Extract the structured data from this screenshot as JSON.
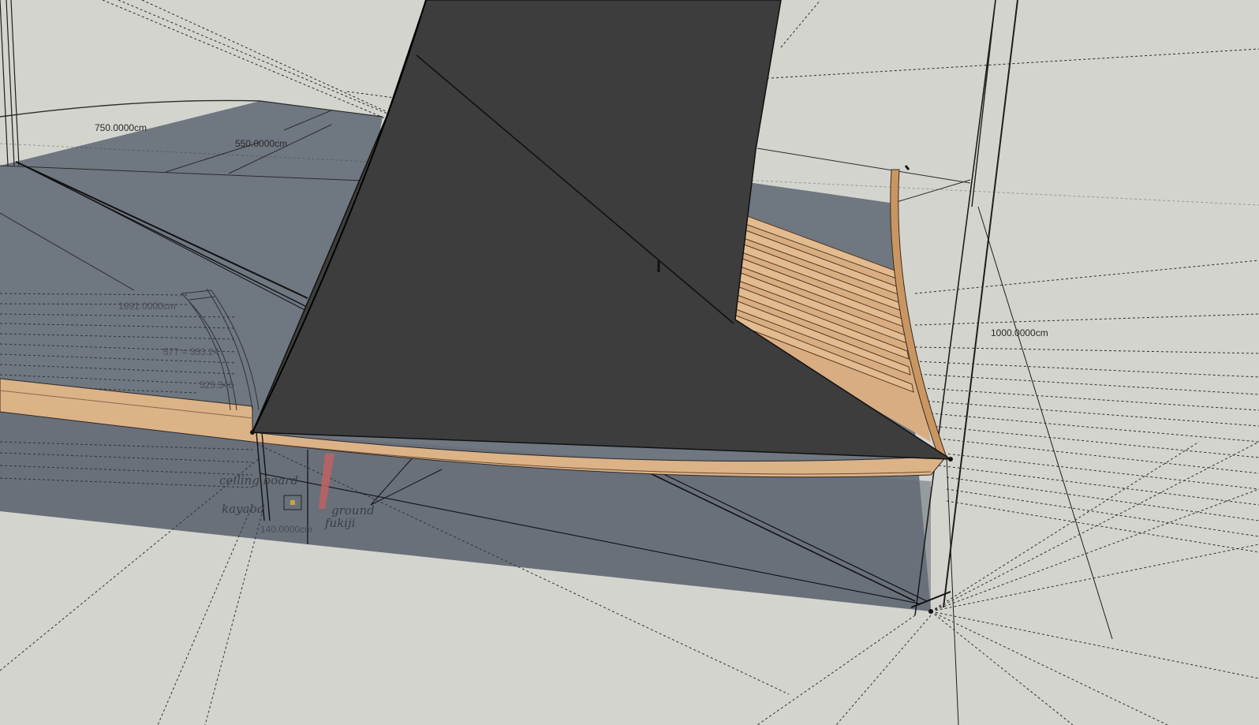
{
  "viewport": {
    "background": "#d3d4ce",
    "ground_color": "#6f7780",
    "sail_color": "#3e3e3e",
    "wood_color": "#d9a878"
  },
  "dimensions": {
    "d750": "750.0000cm",
    "d550": "550.0000cm",
    "d1000": "1000.0000cm",
    "d1691": "1691.0000cm",
    "d577": "577 = 353.24",
    "d525": "525.346",
    "d140": "140.0000cm"
  },
  "annotations": {
    "note1": "ceiling board",
    "note2": "kayaba",
    "note3": "fukiji",
    "note4": "ground"
  }
}
